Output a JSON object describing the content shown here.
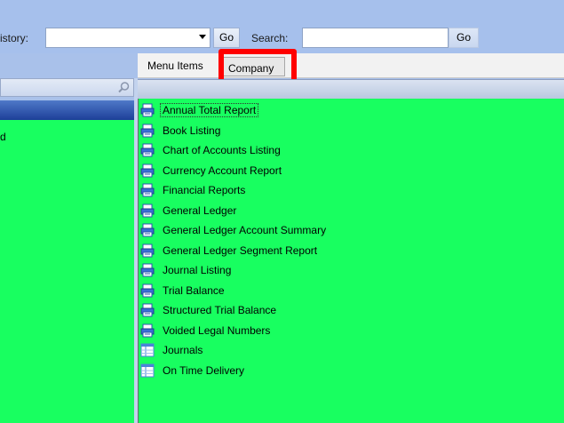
{
  "toolbar": {
    "history_label": "istory:",
    "history_value": "",
    "go_label": "Go",
    "search_label": "Search:",
    "search_value": "",
    "search_go_label": "Go"
  },
  "tabs": [
    {
      "label": "Menu Items"
    },
    {
      "label": "Company"
    }
  ],
  "left_tree": {
    "visible_item_fragment": "d"
  },
  "menu_items": [
    {
      "label": "Annual Total Report",
      "icon": "printer-icon"
    },
    {
      "label": "Book Listing",
      "icon": "printer-icon"
    },
    {
      "label": "Chart of Accounts Listing",
      "icon": "printer-icon"
    },
    {
      "label": "Currency Account Report",
      "icon": "printer-icon"
    },
    {
      "label": "Financial Reports",
      "icon": "printer-icon"
    },
    {
      "label": "General Ledger",
      "icon": "printer-icon"
    },
    {
      "label": "General Ledger Account Summary",
      "icon": "printer-icon"
    },
    {
      "label": "General Ledger Segment Report",
      "icon": "printer-icon"
    },
    {
      "label": "Journal Listing",
      "icon": "printer-icon"
    },
    {
      "label": "Trial Balance",
      "icon": "printer-icon"
    },
    {
      "label": "Structured Trial Balance",
      "icon": "printer-icon"
    },
    {
      "label": "Voided Legal Numbers",
      "icon": "printer-icon"
    },
    {
      "label": "Journals",
      "icon": "grid-icon"
    },
    {
      "label": "On Time Delivery",
      "icon": "grid-icon"
    }
  ],
  "colors": {
    "list_background": "#18ff60",
    "toolbar_background": "#a6c0ec",
    "selected_row": "#2a4fa8",
    "annotation": "#ff0000"
  }
}
